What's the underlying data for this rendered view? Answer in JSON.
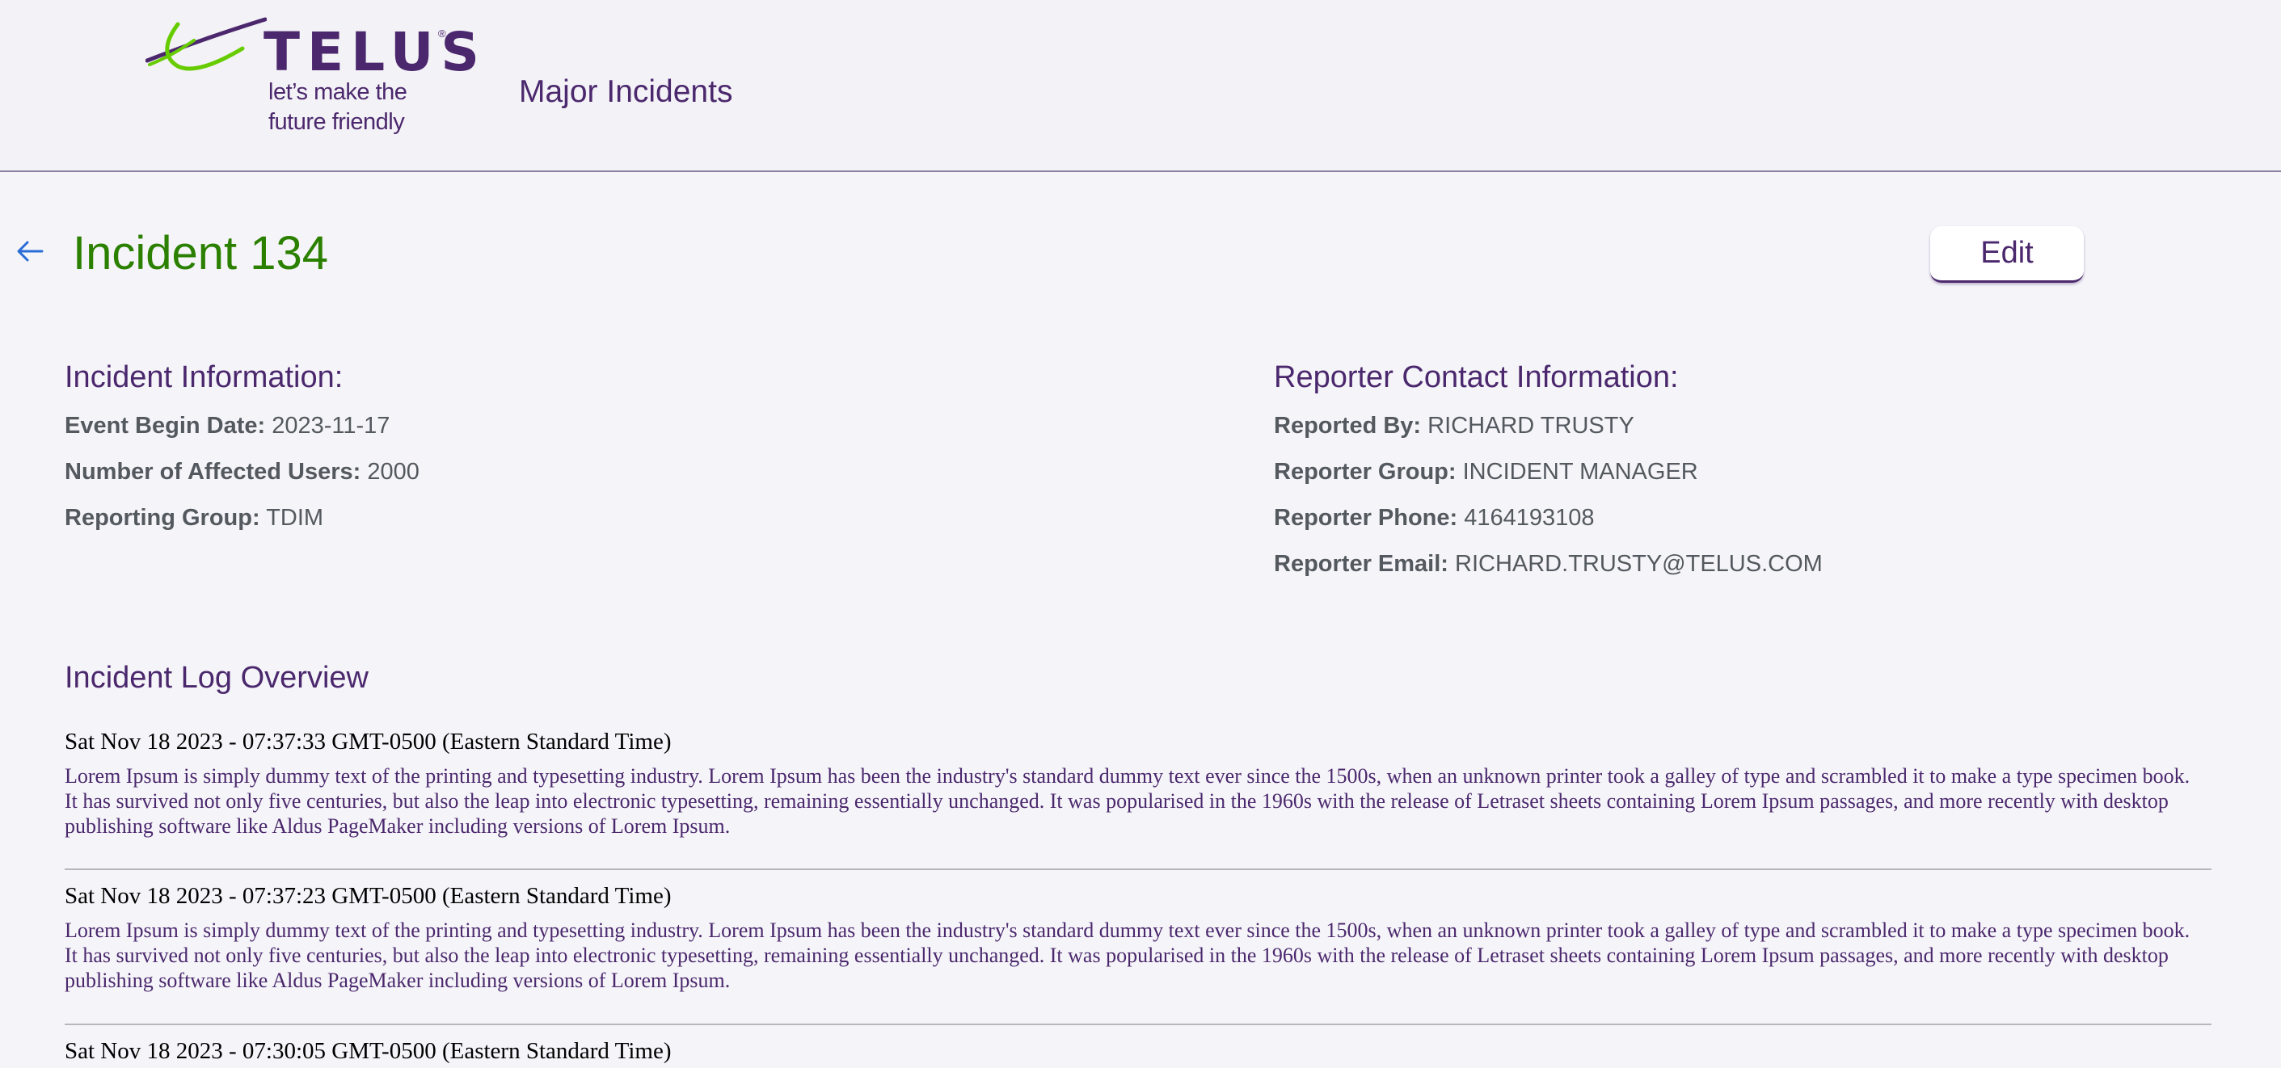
{
  "header": {
    "logo_word": "TELUS",
    "logo_tag_line1": "let’s make the",
    "logo_tag_line2": "future friendly",
    "app_title": "Major Incidents"
  },
  "page": {
    "title": "Incident 134",
    "edit_label": "Edit"
  },
  "incident_info": {
    "title": "Incident Information:",
    "rows": [
      {
        "label": "Event Begin Date:",
        "value": "2023-11-17"
      },
      {
        "label": "Number of Affected Users:",
        "value": "2000"
      },
      {
        "label": "Reporting Group:",
        "value": "TDIM"
      }
    ]
  },
  "reporter_info": {
    "title": "Reporter Contact Information:",
    "rows": [
      {
        "label": "Reported By:",
        "value": "RICHARD TRUSTY"
      },
      {
        "label": "Reporter Group:",
        "value": "INCIDENT MANAGER"
      },
      {
        "label": "Reporter Phone:",
        "value": "4164193108"
      },
      {
        "label": "Reporter Email:",
        "value": "RICHARD.TRUSTY@TELUS.COM"
      }
    ]
  },
  "log": {
    "title": "Incident Log Overview",
    "entries": [
      {
        "timestamp": "Sat Nov 18 2023 - 07:37:33 GMT-0500 (Eastern Standard Time)",
        "text": "Lorem Ipsum is simply dummy text of the printing and typesetting industry. Lorem Ipsum has been the industry's standard dummy text ever since the 1500s, when an unknown printer took a galley of type and scrambled it to make a type specimen book. It has survived not only five centuries, but also the leap into electronic typesetting, remaining essentially unchanged. It was popularised in the 1960s with the release of Letraset sheets containing Lorem Ipsum passages, and more recently with desktop publishing software like Aldus PageMaker including versions of Lorem Ipsum."
      },
      {
        "timestamp": "Sat Nov 18 2023 - 07:37:23 GMT-0500 (Eastern Standard Time)",
        "text": "Lorem Ipsum is simply dummy text of the printing and typesetting industry. Lorem Ipsum has been the industry's standard dummy text ever since the 1500s, when an unknown printer took a galley of type and scrambled it to make a type specimen book. It has survived not only five centuries, but also the leap into electronic typesetting, remaining essentially unchanged. It was popularised in the 1960s with the release of Letraset sheets containing Lorem Ipsum passages, and more recently with desktop publishing software like Aldus PageMaker including versions of Lorem Ipsum."
      },
      {
        "timestamp": "Sat Nov 18 2023 - 07:30:05 GMT-0500 (Eastern Standard Time)",
        "text": ""
      }
    ]
  },
  "colors": {
    "brand_purple": "#4b286d",
    "brand_green": "#2b8000",
    "logo_green": "#66cc00",
    "back_arrow": "#2a6cd6"
  },
  "icons": {
    "back": "arrow-left-icon",
    "logo_mark": "telus-logo-icon"
  }
}
